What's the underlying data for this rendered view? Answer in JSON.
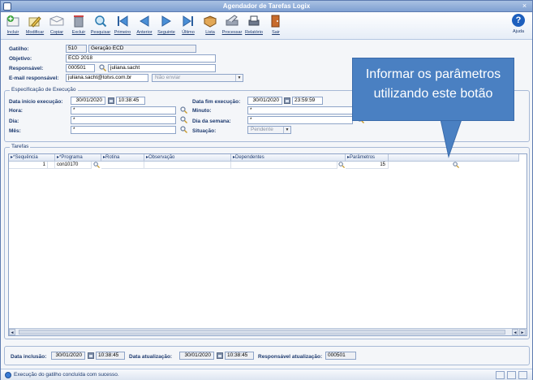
{
  "window": {
    "title": "Agendador de Tarefas Logix",
    "close_label": "×"
  },
  "toolbar": {
    "buttons": [
      {
        "label": "Incluir",
        "icon": "add-icon"
      },
      {
        "label": "Modificar",
        "icon": "edit-icon"
      },
      {
        "label": "Copiar",
        "icon": "copy-icon"
      },
      {
        "label": "Excluir",
        "icon": "delete-icon"
      },
      {
        "label": "Pesquisar",
        "icon": "search-icon"
      },
      {
        "label": "Primeiro",
        "icon": "first-icon"
      },
      {
        "label": "Anterior",
        "icon": "previous-icon"
      },
      {
        "label": "Seguinte",
        "icon": "next-icon"
      },
      {
        "label": "Último",
        "icon": "last-icon"
      },
      {
        "label": "Lista",
        "icon": "list-icon"
      },
      {
        "label": "Processar",
        "icon": "process-icon"
      },
      {
        "label": "Relatório",
        "icon": "report-icon"
      },
      {
        "label": "Sair",
        "icon": "exit-icon"
      }
    ],
    "help_label": "Ajuda",
    "help_glyph": "?"
  },
  "header": {
    "gatilho_label": "Gatilho:",
    "gatilho_code": "510",
    "gatilho_desc": "Geração ECD",
    "objetivo_label": "Objetivo:",
    "objetivo_value": "ECD 2018",
    "responsavel_label": "Responsável:",
    "responsavel_code": "000501",
    "responsavel_name": "juliana.sacht",
    "email_label": "E-mail responsável:",
    "email_value": "juliana.sacht@totvs.com.br",
    "email_option": "Não enviar"
  },
  "schedule": {
    "group_title": "Especificação de Execução",
    "data_inicio_label": "Data início execução:",
    "data_inicio": "30/01/2020",
    "hora_inicio": "10:38:45",
    "data_fim_label": "Data fim execução:",
    "data_fim": "30/01/2020",
    "hora_fim": "23:59:59",
    "hora_label": "Hora:",
    "hora_value": "*",
    "minuto_label": "Minuto:",
    "minuto_value": "*",
    "dia_label": "Dia:",
    "dia_value": "*",
    "dia_semana_label": "Dia da semana:",
    "dia_semana_value": "*",
    "mes_label": "Mês:",
    "mes_value": "*",
    "situacao_label": "Situação:",
    "situacao_value": "Pendente"
  },
  "tasks": {
    "group_title": "Tarefas",
    "columns": [
      "*Sequência",
      "*Programa",
      "Rotina",
      "Observação",
      "Dependentes",
      "Parâmetros"
    ],
    "rows": [
      {
        "sequencia": "1",
        "programa": "con10170",
        "rotina": "",
        "observacao": "",
        "dependentes": "",
        "parametros": "15"
      }
    ],
    "scroll_left": "◄",
    "scroll_right": "►"
  },
  "footer": {
    "data_inclusao_label": "Data inclusão:",
    "data_inclusao": "30/01/2020",
    "hora_inclusao": "10:38:45",
    "data_atualizacao_label": "Data atualização:",
    "data_atualizacao": "30/01/2020",
    "hora_atualizacao": "10:38:45",
    "responsavel_atualizacao_label": "Responsável atualização:",
    "responsavel_atualizacao": "000501"
  },
  "status": {
    "message": "Execução do gatilho concluída com sucesso."
  },
  "callout": {
    "line1": "Informar os parâmetros",
    "line2": "utilizando este botão"
  },
  "colors": {
    "callout": "#4a80c2",
    "titlebar": "#7fa0d2",
    "label": "#1d3a6f"
  }
}
